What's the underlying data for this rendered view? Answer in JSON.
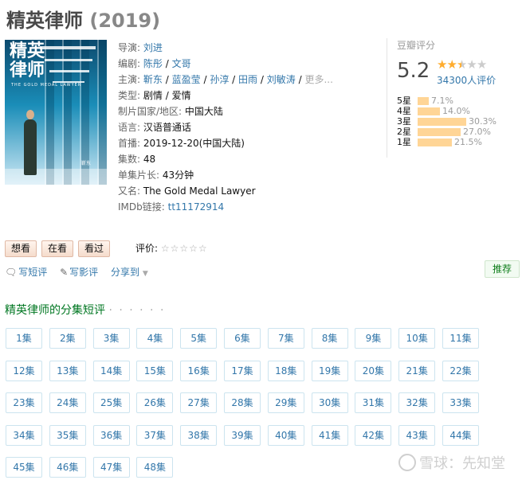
{
  "title": {
    "name": "精英律师",
    "year": "(2019)"
  },
  "poster": {
    "title": "精英律师",
    "subtitle": "THE GOLD MEDAL LAWYER",
    "actor": "靳东"
  },
  "info": {
    "director": {
      "label": "导演:",
      "names": [
        "刘进"
      ]
    },
    "writer": {
      "label": "编剧:",
      "names": [
        "陈彤",
        "文哥"
      ]
    },
    "cast": {
      "label": "主演:",
      "names": [
        "靳东",
        "蓝盈莹",
        "孙淳",
        "田雨",
        "刘敏涛"
      ],
      "more": "更多..."
    },
    "genre": {
      "label": "类型:",
      "values": [
        "剧情",
        "爱情"
      ]
    },
    "country": {
      "label": "制片国家/地区:",
      "value": "中国大陆"
    },
    "language": {
      "label": "语言:",
      "value": "汉语普通话"
    },
    "premiere": {
      "label": "首播:",
      "value": "2019-12-20(中国大陆)"
    },
    "episodes": {
      "label": "集数:",
      "value": "48"
    },
    "runtime": {
      "label": "单集片长:",
      "value": "43分钟"
    },
    "aka": {
      "label": "又名:",
      "value": "The Gold Medal Lawyer"
    },
    "imdb": {
      "label": "IMDb链接:",
      "value": "tt11172914"
    }
  },
  "rating": {
    "label": "豆瓣评分",
    "score": "5.2",
    "stars": 2.5,
    "votes": "34300人评价",
    "distribution": [
      {
        "label": "5星",
        "pct": 7.1,
        "text": "7.1%"
      },
      {
        "label": "4星",
        "pct": 14.0,
        "text": "14.0%"
      },
      {
        "label": "3星",
        "pct": 30.3,
        "text": "30.3%"
      },
      {
        "label": "2星",
        "pct": 27.0,
        "text": "27.0%"
      },
      {
        "label": "1星",
        "pct": 21.5,
        "text": "21.5%"
      }
    ],
    "bar_color": "#ffd596",
    "star_color": "#ffac2d"
  },
  "actions": {
    "want": "想看",
    "watching": "在看",
    "watched": "看过",
    "rate_label": "评价:",
    "rate_stars": "☆☆☆☆☆"
  },
  "tools": {
    "short_review": "写短评",
    "review": "写影评",
    "share": "分享到"
  },
  "recommend": "推荐",
  "section_title": "精英律师的分集短评",
  "section_dots": "· · · · · ·",
  "episode_suffix": "集",
  "episode_count": 48,
  "watermark": "雪球：先知堂"
}
